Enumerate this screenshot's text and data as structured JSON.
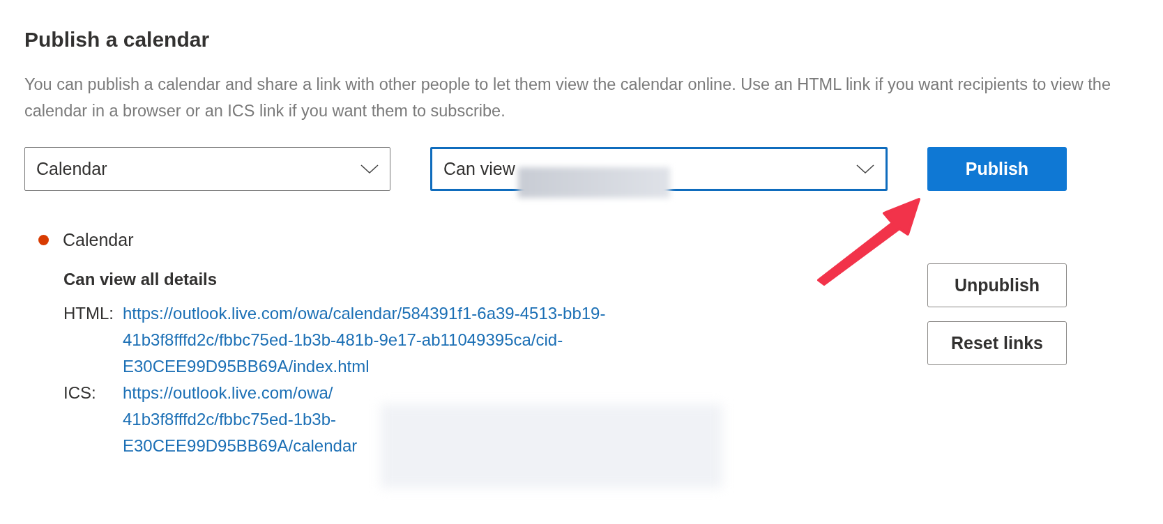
{
  "title": "Publish a calendar",
  "description": "You can publish a calendar and share a link with other people to let them view the calendar online. Use an HTML link if you want recipients to view the calendar in a browser or an ICS link if you want them to subscribe.",
  "calendar_dropdown": {
    "value": "Calendar",
    "focused": false
  },
  "permission_dropdown": {
    "value": "Can view",
    "focused": true
  },
  "publish_button": "Publish",
  "published": [
    {
      "name": "Calendar",
      "color": "#d83b01",
      "permission": "Can view all details",
      "links": [
        {
          "label": "HTML:",
          "lines": [
            "https://outlook.live.com/owa/calendar/584391f1-6a39-4513-bb19-",
            "41b3f8fffd2c/fbbc75ed-1b3b-481b-9e17-ab11049395ca/cid-",
            "E30CEE99D95BB69A/index.html"
          ]
        },
        {
          "label": "ICS:",
          "lines": [
            "https://outlook.live.com/owa/",
            "41b3f8fffd2c/fbbc75ed-1b3b-",
            "E30CEE99D95BB69A/calendar"
          ]
        }
      ]
    }
  ],
  "side_buttons": [
    "Unpublish",
    "Reset links"
  ]
}
